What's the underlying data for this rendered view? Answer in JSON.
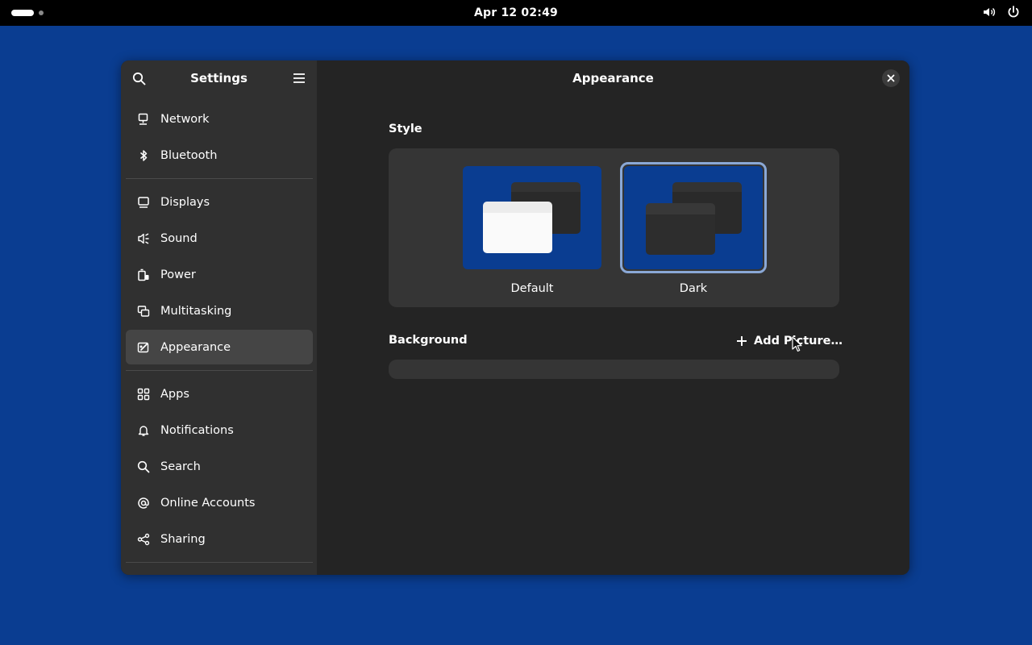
{
  "topbar": {
    "clock": "Apr 12  02:49",
    "icons": [
      "volume-icon",
      "power-icon"
    ]
  },
  "sidebar": {
    "title": "Settings",
    "groups": [
      [
        {
          "label": "Network",
          "icon": "network-icon"
        },
        {
          "label": "Bluetooth",
          "icon": "bluetooth-icon"
        }
      ],
      [
        {
          "label": "Displays",
          "icon": "display-icon"
        },
        {
          "label": "Sound",
          "icon": "speaker-icon"
        },
        {
          "label": "Power",
          "icon": "battery-icon"
        },
        {
          "label": "Multitasking",
          "icon": "multitasking-icon"
        },
        {
          "label": "Appearance",
          "icon": "appearance-icon",
          "selected": true
        }
      ],
      [
        {
          "label": "Apps",
          "icon": "apps-grid-icon"
        },
        {
          "label": "Notifications",
          "icon": "bell-icon"
        },
        {
          "label": "Search",
          "icon": "search-icon"
        },
        {
          "label": "Online Accounts",
          "icon": "at-sign-icon"
        },
        {
          "label": "Sharing",
          "icon": "share-icon"
        }
      ]
    ]
  },
  "content": {
    "title": "Appearance",
    "style_section": {
      "label": "Style",
      "options": [
        {
          "label": "Default",
          "selected": false
        },
        {
          "label": "Dark",
          "selected": true
        }
      ]
    },
    "background_section": {
      "label": "Background",
      "add_picture_label": "Add Picture…"
    }
  },
  "colors": {
    "desktop": "#0a3d91",
    "window_bg": "#242424",
    "sidebar_bg": "#303030",
    "selected_item": "#454545",
    "selection_ring": "#8aa8d6"
  }
}
